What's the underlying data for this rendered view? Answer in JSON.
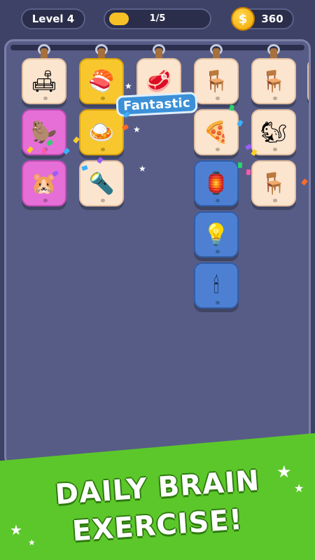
{
  "hud": {
    "level_label": "Level 4",
    "progress_text": "1/5",
    "progress": 0.2,
    "coins": "360",
    "coin_symbol": "$"
  },
  "feedback": {
    "text": "Fantastic"
  },
  "banner": {
    "line1": "DAILY BRAIN",
    "line2": "EXERCISE!"
  },
  "columns": [
    {
      "tiles": [
        {
          "icon": "sofa-icon",
          "glyph": "🛋",
          "color": "cream"
        },
        {
          "icon": "beaver-icon",
          "glyph": "🦫",
          "color": "pink"
        },
        {
          "icon": "hamster-icon",
          "glyph": "🐹",
          "color": "pink"
        }
      ]
    },
    {
      "tiles": [
        {
          "icon": "sushi-icon",
          "glyph": "🍣",
          "color": "yellow"
        },
        {
          "icon": "curry-icon",
          "glyph": "🍛",
          "color": "yellow"
        },
        {
          "icon": "flashlight-icon",
          "glyph": "🔦",
          "color": "cream"
        }
      ]
    },
    {
      "tiles": [
        {
          "icon": "steak-icon",
          "glyph": "🥩",
          "color": "cream"
        }
      ]
    },
    {
      "tiles": [
        {
          "icon": "bench-icon",
          "glyph": "🪑",
          "color": "cream"
        },
        {
          "icon": "pizza-icon",
          "glyph": "🍕",
          "color": "cream"
        },
        {
          "icon": "lantern-icon",
          "glyph": "🏮",
          "color": "blue"
        },
        {
          "icon": "lamp-icon",
          "glyph": "💡",
          "color": "blue"
        },
        {
          "icon": "candle-icon",
          "glyph": "🕯",
          "color": "blue"
        }
      ]
    },
    {
      "tiles": [
        {
          "icon": "chair-icon",
          "glyph": "🪑",
          "color": "cream"
        },
        {
          "icon": "squirrel-icon",
          "glyph": "🐿",
          "color": "cream"
        },
        {
          "icon": "stool-icon",
          "glyph": "🪑",
          "color": "cream"
        }
      ]
    }
  ]
}
